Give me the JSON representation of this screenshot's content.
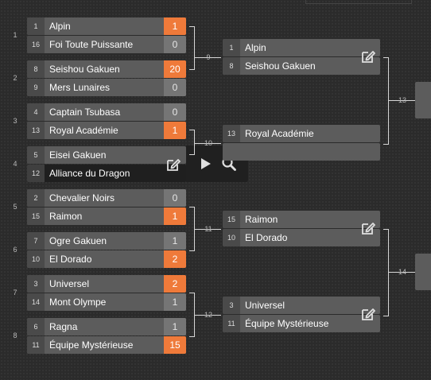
{
  "bracket": {
    "matches": [
      {
        "number": "1",
        "teams": [
          {
            "seed": "1",
            "name": "Alpin",
            "score": "1",
            "winner": true
          },
          {
            "seed": "16",
            "name": "Foi Toute Puissante",
            "score": "0",
            "winner": false
          }
        ]
      },
      {
        "number": "2",
        "teams": [
          {
            "seed": "8",
            "name": "Seishou Gakuen",
            "score": "20",
            "winner": true
          },
          {
            "seed": "9",
            "name": "Mers Lunaires",
            "score": "0",
            "winner": false
          }
        ]
      },
      {
        "number": "3",
        "teams": [
          {
            "seed": "4",
            "name": "Captain Tsubasa",
            "score": "0",
            "winner": false
          },
          {
            "seed": "13",
            "name": "Royal Académie",
            "score": "1",
            "winner": true
          }
        ]
      },
      {
        "number": "4",
        "teams": [
          {
            "seed": "5",
            "name": "Eisei Gakuen",
            "score": "",
            "winner": false
          },
          {
            "seed": "12",
            "name": "Alliance du Dragon",
            "score": "",
            "winner": false
          }
        ]
      },
      {
        "number": "5",
        "teams": [
          {
            "seed": "2",
            "name": "Chevalier Noirs",
            "score": "0",
            "winner": false
          },
          {
            "seed": "15",
            "name": "Raimon",
            "score": "1",
            "winner": true
          }
        ]
      },
      {
        "number": "6",
        "teams": [
          {
            "seed": "7",
            "name": "Ogre Gakuen",
            "score": "1",
            "winner": false
          },
          {
            "seed": "10",
            "name": "El Dorado",
            "score": "2",
            "winner": true
          }
        ]
      },
      {
        "number": "7",
        "teams": [
          {
            "seed": "3",
            "name": "Universel",
            "score": "2",
            "winner": true
          },
          {
            "seed": "14",
            "name": "Mont Olympe",
            "score": "1",
            "winner": false
          }
        ]
      },
      {
        "number": "8",
        "teams": [
          {
            "seed": "6",
            "name": "Ragna",
            "score": "1",
            "winner": false
          },
          {
            "seed": "11",
            "name": "Équipe Mystérieuse",
            "score": "15",
            "winner": true
          }
        ]
      },
      {
        "number": "9",
        "teams": [
          {
            "seed": "1",
            "name": "Alpin"
          },
          {
            "seed": "8",
            "name": "Seishou Gakuen"
          }
        ],
        "editable": true
      },
      {
        "number": "10",
        "teams": [
          {
            "seed": "13",
            "name": "Royal Académie"
          },
          {
            "seed": "",
            "name": ""
          }
        ]
      },
      {
        "number": "11",
        "teams": [
          {
            "seed": "15",
            "name": "Raimon"
          },
          {
            "seed": "10",
            "name": "El Dorado"
          }
        ],
        "editable": true
      },
      {
        "number": "12",
        "teams": [
          {
            "seed": "3",
            "name": "Universel"
          },
          {
            "seed": "11",
            "name": "Équipe Mystérieuse"
          }
        ],
        "editable": true
      },
      {
        "number": "13"
      },
      {
        "number": "14"
      }
    ],
    "hovered_match_tools": [
      "edit-icon",
      "play-icon",
      "search-icon"
    ],
    "colors": {
      "winner_score": "#ef7a3a",
      "card": "#5c5c5c",
      "seed_cell": "#4a4a4a",
      "score_cell": "#757575",
      "connector": "#d6d6d6",
      "background": "#2b2b2b"
    }
  }
}
